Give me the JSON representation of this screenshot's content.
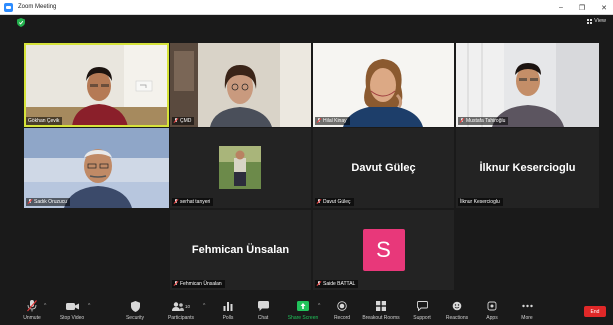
{
  "window": {
    "title": "Zoom Meeting",
    "controls": [
      "–",
      "❐",
      "✕"
    ]
  },
  "top": {
    "view_label": "View"
  },
  "colors": {
    "active_border": "#d6e33a",
    "share_green": "#21c35b",
    "end_red": "#e02828",
    "avatar_pink": "#e8387a"
  },
  "participants": [
    {
      "name": "Gökhan Çevik"
    },
    {
      "name": "ÇMD"
    },
    {
      "name": "Hilal Kinay"
    },
    {
      "name": "Mustafa Tahiroğlu"
    },
    {
      "name": "Sadık Oruzucu"
    },
    {
      "name": "serhat tanyeri"
    },
    {
      "name": "Davut Güleç",
      "display": "Davut Güleç"
    },
    {
      "name": "İlknur Kesercioglu",
      "display": "İlknur Kesercioglu"
    },
    {
      "name": "Fehmican Ünsalan",
      "display": "Fehmican Ünsalan"
    },
    {
      "name": "Saide BATTAL",
      "initial": "S"
    }
  ],
  "toolbar": {
    "unmute": "Unmute",
    "stop_video": "Stop Video",
    "security": "Security",
    "participants": "Participants",
    "participants_count": "10",
    "polls": "Polls",
    "chat": "Chat",
    "share_screen": "Share Screen",
    "record": "Record",
    "breakout_rooms": "Breakout Rooms",
    "support": "Support",
    "reactions": "Reactions",
    "apps": "Apps",
    "more": "More",
    "end": "End"
  }
}
